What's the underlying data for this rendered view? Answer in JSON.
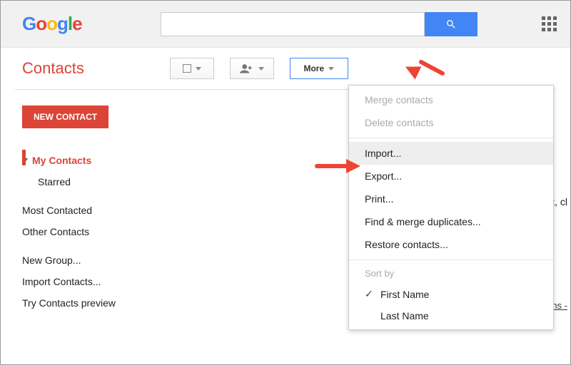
{
  "header": {
    "logo_text": {
      "g1": "G",
      "o1": "o",
      "o2": "o",
      "g2": "g",
      "l": "l",
      "e": "e"
    }
  },
  "toolbar": {
    "contacts_title": "Contacts",
    "more_label": "More"
  },
  "sidebar": {
    "new_contact": "NEW CONTACT",
    "my_contacts": "My Contacts",
    "starred": "Starred",
    "most_contacted": "Most Contacted",
    "other_contacts": "Other Contacts",
    "new_group": "New Group...",
    "import_contacts": "Import Contacts...",
    "try_preview": "Try Contacts preview"
  },
  "menu": {
    "merge": "Merge contacts",
    "delete": "Delete contacts",
    "import": "Import...",
    "export": "Export...",
    "print": "Print...",
    "find_dup": "Find & merge duplicates...",
    "restore": "Restore contacts...",
    "sort_by": "Sort by",
    "first_name": "First Name",
    "last_name": "Last Name"
  },
  "right": {
    "frag": "t, cl",
    "link": "ms -"
  }
}
